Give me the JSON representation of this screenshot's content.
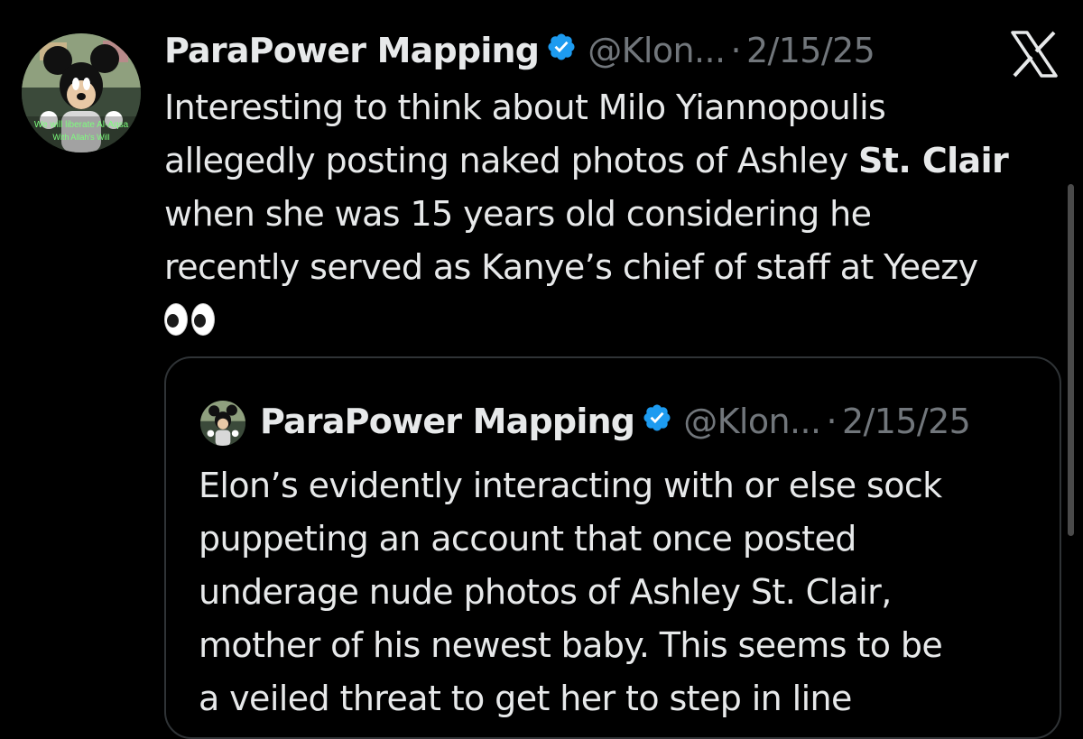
{
  "tweet": {
    "author_name": "ParaPower Mapping",
    "handle": "@Klon...",
    "separator": "·",
    "date": "2/15/25",
    "text_lines": [
      "Interesting to think about Milo Yiannopoulis",
      "allegedly posting naked photos of Ashley",
      "St. Clair",
      "when she was 15 years old considering he",
      "recently served as Kanye’s chief of staff at Yeezy"
    ],
    "emoji_icon": "eyes-emoji",
    "avatar_caption_line1": "We will liberate Al-Aqsa",
    "avatar_caption_line2": "With Allah's Will"
  },
  "quoted": {
    "author_name": "ParaPower Mapping",
    "handle": "@Klon...",
    "separator": "·",
    "date": "2/15/25",
    "text_lines": [
      "Elon’s evidently interacting with or else sock",
      "puppeting an account that once posted",
      "underage nude photos of Ashley St. Clair,",
      "mother of his newest baby. This seems to be",
      "a veiled threat to get her to step in line"
    ]
  },
  "icons": {
    "platform": "x-logo-icon",
    "verified": "verified-badge-icon"
  },
  "colors": {
    "background": "#000000",
    "text": "#e7e9ea",
    "muted": "#71767b",
    "verified": "#1d9bf0",
    "border": "#2f3336"
  }
}
